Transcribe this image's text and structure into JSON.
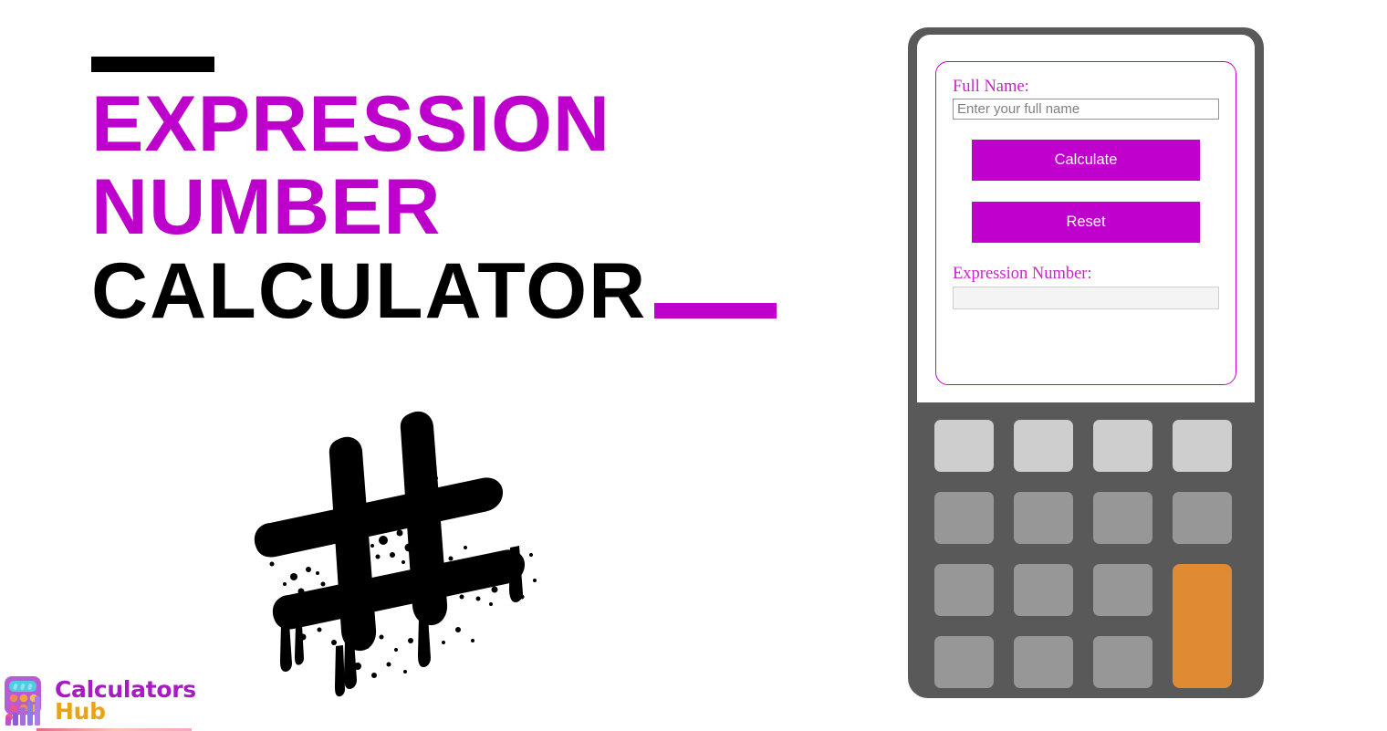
{
  "page": {
    "background": "#ffffff",
    "accent_purple": "#BD00CC",
    "accent_magenta": "#CC00CC",
    "accent_orange": "#DF8B33",
    "device_body": "#595959"
  },
  "hero": {
    "rule_top": "",
    "title_line_1": "EXPRESSION",
    "title_line_2": "NUMBER",
    "title_line_3": "CALCULATOR",
    "rule_bottom": "",
    "graphic_name": "hashtag-graffiti"
  },
  "logo": {
    "icon_name": "calculators-hub-logo-icon",
    "word_1": "Calculators",
    "word_2": "Hub"
  },
  "calculator": {
    "form": {
      "name_label": "Full Name:",
      "name_value": "",
      "name_placeholder": "Enter your full name",
      "calculate_label": "Calculate",
      "reset_label": "Reset",
      "result_label": "Expression Number:",
      "result_value": ""
    },
    "keypad": {
      "rows": [
        [
          {
            "label": "",
            "style": "light"
          },
          {
            "label": "",
            "style": "light"
          },
          {
            "label": "",
            "style": "light"
          },
          {
            "label": "",
            "style": "light"
          }
        ],
        [
          {
            "label": "",
            "style": "mid"
          },
          {
            "label": "",
            "style": "mid"
          },
          {
            "label": "",
            "style": "mid"
          },
          {
            "label": "",
            "style": "mid"
          }
        ],
        [
          {
            "label": "",
            "style": "mid"
          },
          {
            "label": "",
            "style": "mid"
          },
          {
            "label": "",
            "style": "mid"
          },
          {
            "label": "",
            "style": "accent"
          }
        ],
        [
          {
            "label": "",
            "style": "mid"
          },
          {
            "label": "",
            "style": "mid"
          },
          {
            "label": "",
            "style": "mid"
          }
        ]
      ]
    }
  }
}
